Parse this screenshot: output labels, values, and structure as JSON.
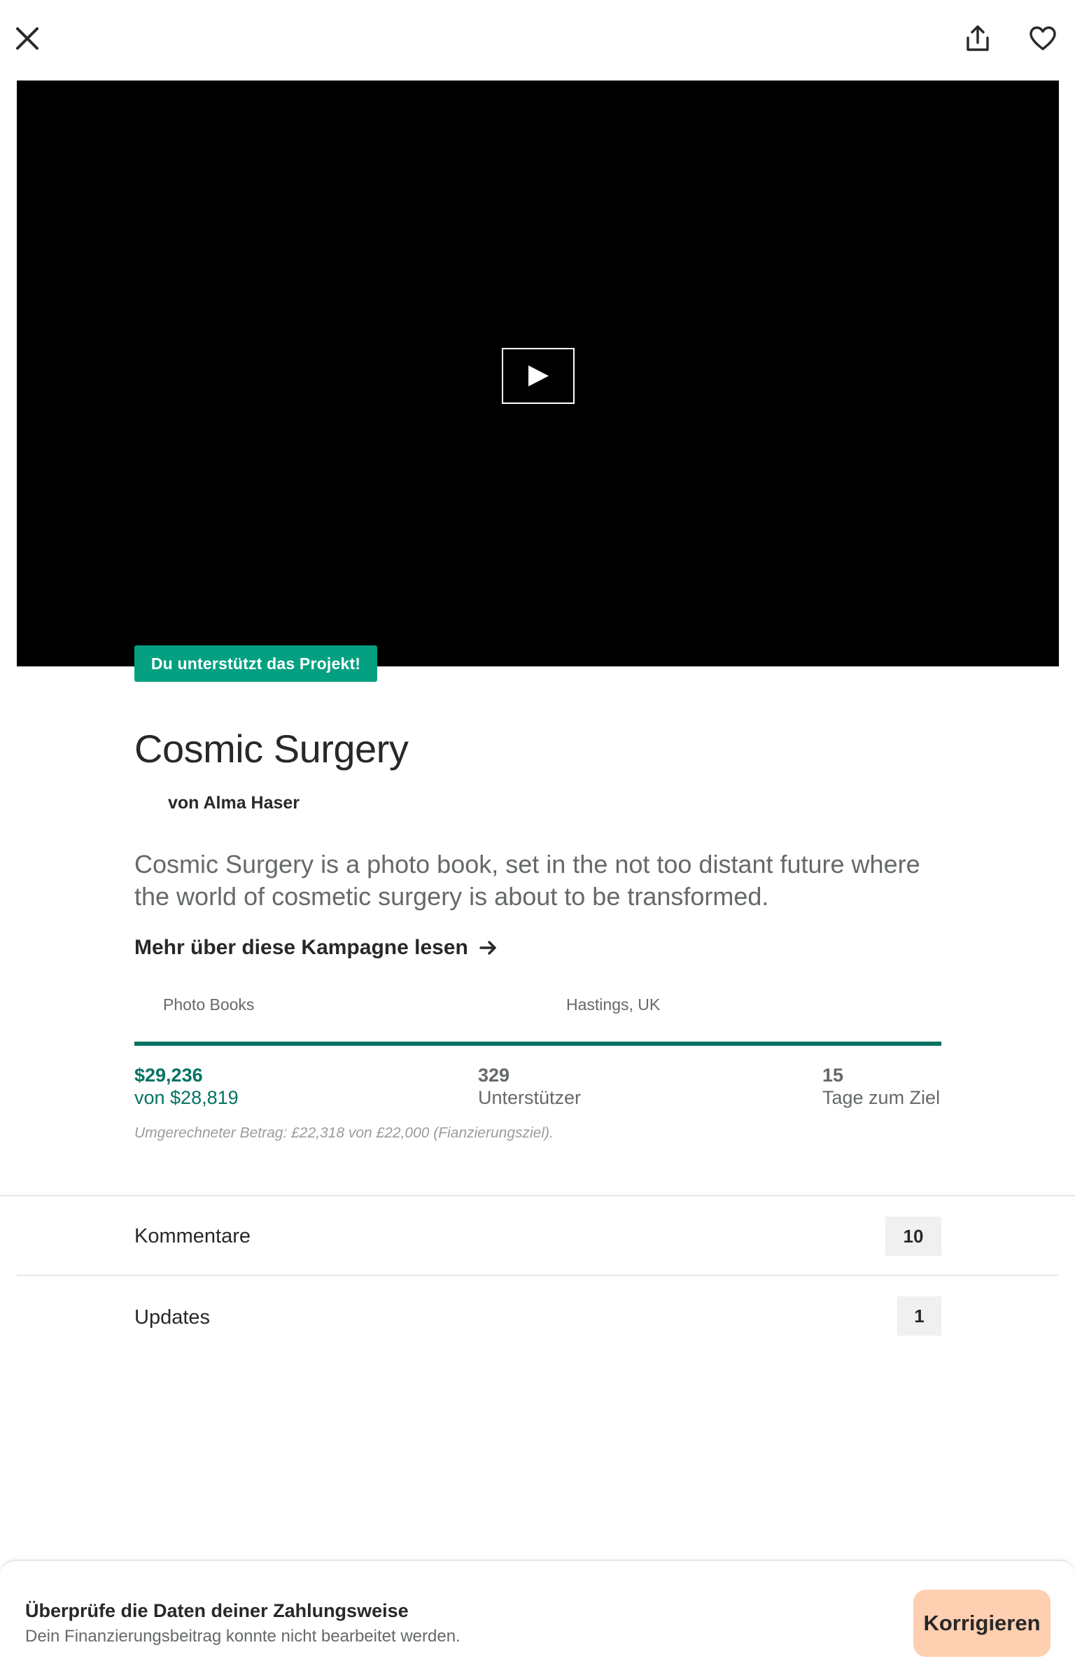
{
  "colors": {
    "brand_green": "#05a081",
    "funded_green": "#037362",
    "progress_track": "#05ce78",
    "video_bg": "#000000",
    "fix_button_bg": "#ffcfb1",
    "count_badge_bg": "#f0f0f0"
  },
  "icons": {
    "close": "close-icon",
    "share": "share-icon",
    "favorite": "heart-icon",
    "play": "play-icon",
    "read_more": "arrow-right-icon"
  },
  "project": {
    "backer_badge": "Du unterstützt das Projekt!",
    "title": "Cosmic Surgery",
    "creator": "von Alma Haser",
    "blurb": "Cosmic Surgery is a photo book, set in the not too distant future where the world of cosmetic surgery is about to be transformed.",
    "read_more": "Mehr über diese Kampagne lesen",
    "category": "Photo Books",
    "location": "Hastings, UK"
  },
  "funding": {
    "progress_percent": 100,
    "pledged": "$29,236",
    "goal": "von $28,819",
    "backers_count": "329",
    "backers_label": "Unterstützer",
    "days_count": "15",
    "days_label": "Tage zum Ziel",
    "conversion_note": "Umgerechneter Betrag: £22,318 von £22,000 (Fianzierungsziel)."
  },
  "sections": {
    "comments_label": "Kommentare",
    "comments_count": "10",
    "updates_label": "Updates",
    "updates_count": "1"
  },
  "payment_banner": {
    "title": "Überprüfe die Daten deiner Zahlungsweise",
    "subtitle": "Dein Finanzierungsbeitrag konnte nicht bearbeitet werden.",
    "button": "Korrigieren"
  }
}
